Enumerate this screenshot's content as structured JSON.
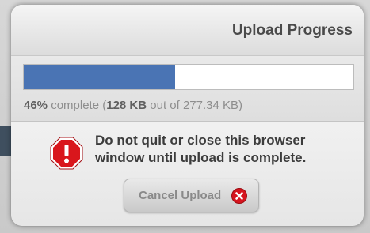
{
  "dialog": {
    "title": "Upload Progress"
  },
  "progress": {
    "fraction": 0.46,
    "percent_text": "46%",
    "complete_word": " complete (",
    "uploaded_text": "128 KB",
    "out_of_text": " out of 277.34 KB)"
  },
  "warning": {
    "message": "Do not quit or close this browser window until upload is complete.",
    "icon": "stop-warning-icon",
    "icon_color": "#d9161c"
  },
  "cancel_button": {
    "label": "Cancel Upload",
    "icon": "close-circle-icon",
    "icon_color": "#d6141e"
  },
  "colors": {
    "progress_fill": "#4a74b4",
    "progress_track": "#ffffff"
  }
}
